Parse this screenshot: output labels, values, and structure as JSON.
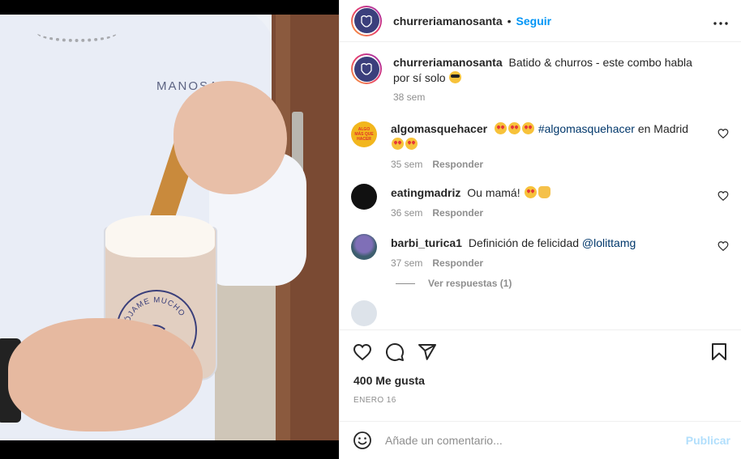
{
  "header": {
    "username": "churreriamanosanta",
    "separator": "•",
    "follow_label": "Seguir",
    "more_label": "•••"
  },
  "caption": {
    "username": "churreriamanosanta",
    "text": "Batido & churros - este combo habla por sí solo",
    "emoji": "smiling-face-with-sunglasses",
    "time": "38 sem"
  },
  "photo": {
    "shirt_text": "MANOSAN",
    "cup_text": "MÓJAME MUCHO"
  },
  "comments": [
    {
      "username": "algomasquehacer",
      "avatar_text": "ALGO MÁS QUE HACER",
      "emojis_before": [
        "heart-eyes",
        "heart-eyes",
        "heart-eyes"
      ],
      "hashtag": "#algomasquehacer",
      "text_after": "en Madrid",
      "emojis_after": [
        "heart-eyes",
        "heart-eyes"
      ],
      "time": "35 sem",
      "reply_label": "Responder"
    },
    {
      "username": "eatingmadriz",
      "text": "Ou mamá!",
      "emojis_after": [
        "heart-eyes",
        "raising-hands"
      ],
      "time": "36 sem",
      "reply_label": "Responder"
    },
    {
      "username": "barbi_turica1",
      "text": "Definición de felicidad",
      "mention": "@lolittamg",
      "time": "37 sem",
      "reply_label": "Responder",
      "view_replies": "Ver respuestas (1)"
    }
  ],
  "actions": {
    "likes": "400 Me gusta",
    "date": "ENERO 16",
    "icons": [
      "heart-icon",
      "comment-icon",
      "share-icon",
      "bookmark-icon"
    ]
  },
  "add_comment": {
    "placeholder": "Añade un comentario...",
    "publish_label": "Publicar"
  },
  "colors": {
    "accent": "#0095f6",
    "publish_disabled": "#b2dffc",
    "muted": "#8e8e8e",
    "text": "#262626",
    "link": "#00376b"
  }
}
